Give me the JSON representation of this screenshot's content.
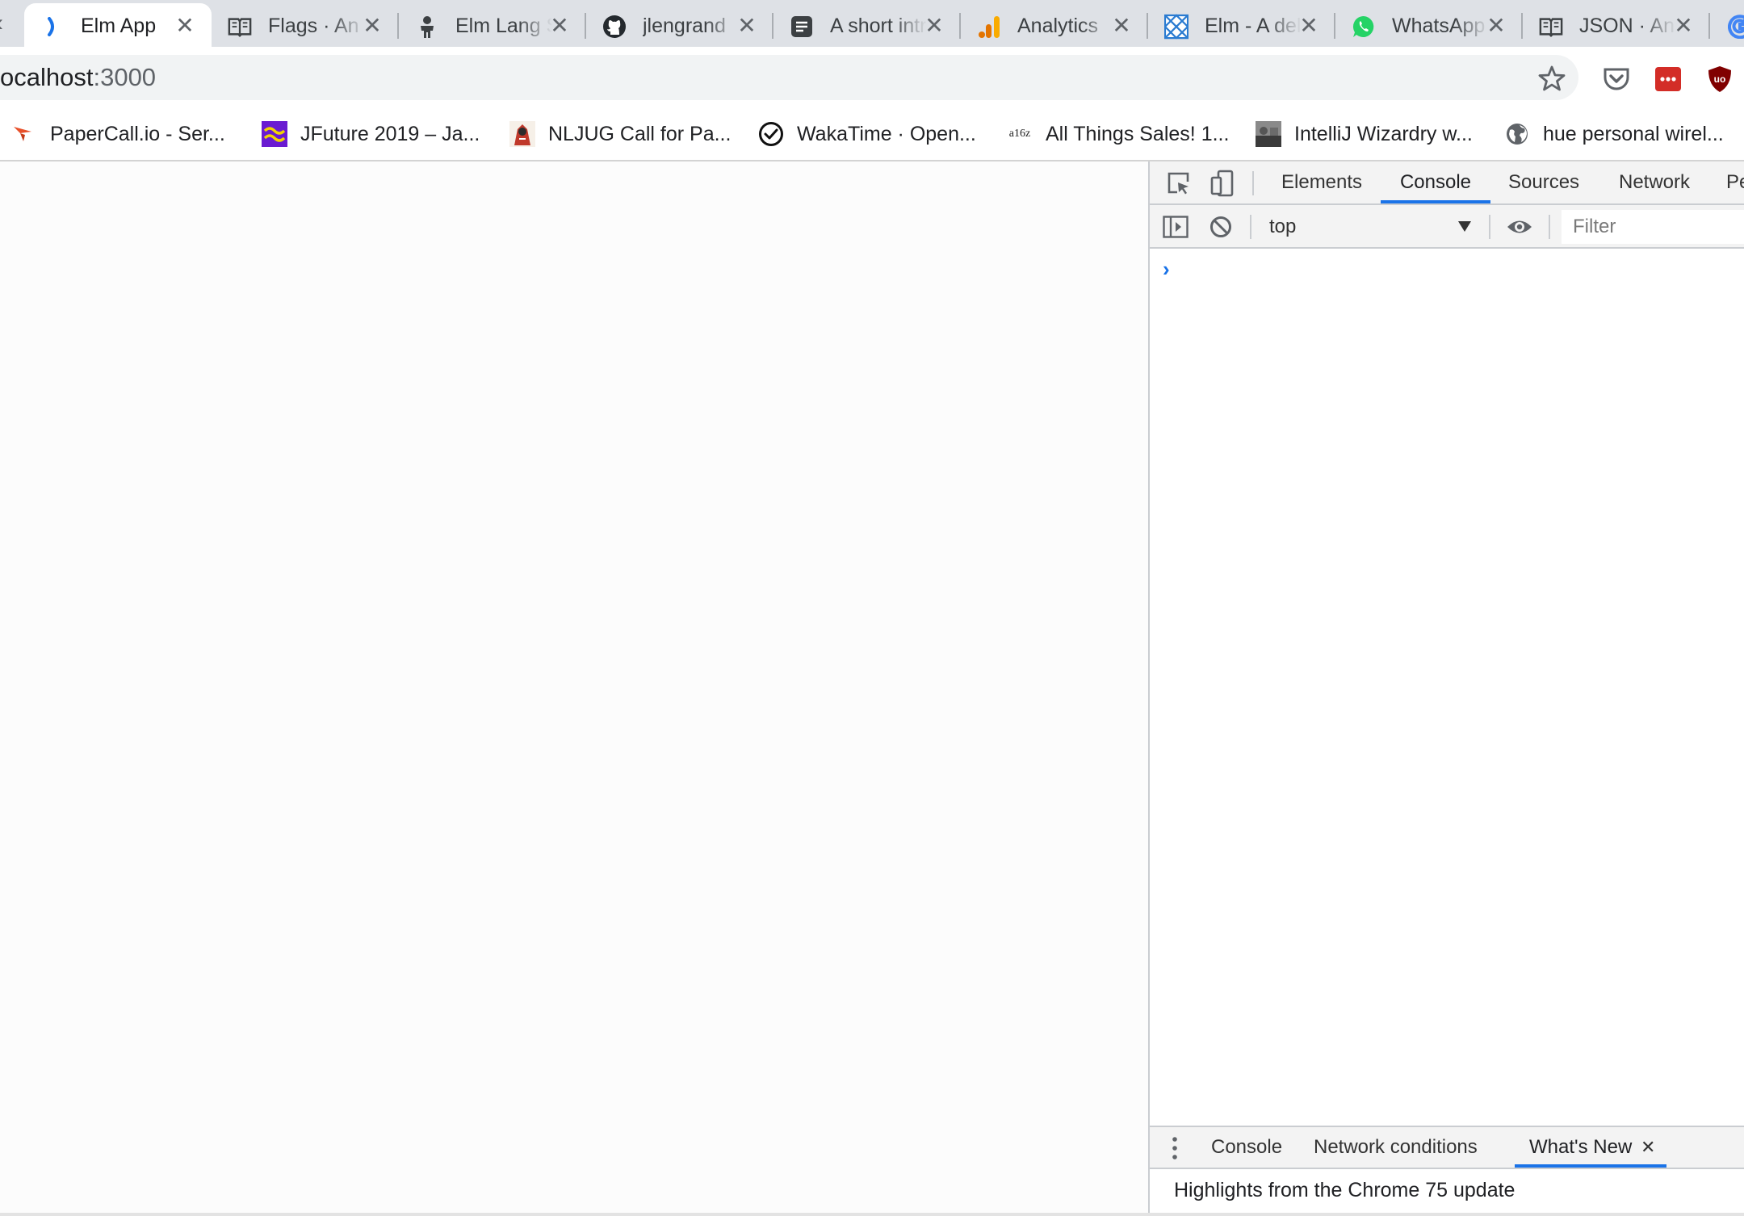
{
  "tabs": [
    {
      "title": "Elm App",
      "icon": "elm-logo-icon",
      "active": true
    },
    {
      "title": "Flags · An Introduction to Elm",
      "icon": "book-icon"
    },
    {
      "title": "Elm Lang Slack",
      "icon": "person-icon"
    },
    {
      "title": "jlengrand",
      "icon": "github-icon"
    },
    {
      "title": "A short introduction",
      "icon": "document-icon"
    },
    {
      "title": "Analytics",
      "icon": "analytics-icon"
    },
    {
      "title": "Elm - A delightful language",
      "icon": "elm-blue-icon"
    },
    {
      "title": "WhatsApp",
      "icon": "whatsapp-icon"
    },
    {
      "title": "JSON · An Introduction to Elm",
      "icon": "book-icon"
    }
  ],
  "address": {
    "host": "ocalhost",
    "port": ":3000"
  },
  "extensions": [
    "pocket-icon",
    "lastpass-icon",
    "ublock-icon"
  ],
  "bookmarks": [
    {
      "label": "PaperCall.io - Ser...",
      "icon": "papercall-icon"
    },
    {
      "label": "JFuture 2019 – Ja...",
      "icon": "jfuture-icon"
    },
    {
      "label": "NLJUG Call for Pa...",
      "icon": "nljug-icon"
    },
    {
      "label": "WakaTime · Open...",
      "icon": "wakatime-icon"
    },
    {
      "label": "All Things Sales! 1...",
      "icon": "a16z-icon",
      "icon_text": "a16z"
    },
    {
      "label": "IntelliJ Wizardry w...",
      "icon": "intellij-thumbnail-icon"
    },
    {
      "label": "hue personal wirel...",
      "icon": "globe-icon"
    }
  ],
  "devtools": {
    "tabs": [
      "Elements",
      "Console",
      "Sources",
      "Network",
      "Pe"
    ],
    "active_tab": "Console",
    "context": "top",
    "filter_placeholder": "Filter",
    "prompt": "›",
    "drawer": {
      "tabs": [
        "Console",
        "Network conditions",
        "What's New"
      ],
      "active_tab": "What's New",
      "close": "✕",
      "highlights": "Highlights from the Chrome 75 update"
    }
  },
  "colors": {
    "accent": "#1a73e8",
    "tabstrip": "#dee1e6"
  }
}
